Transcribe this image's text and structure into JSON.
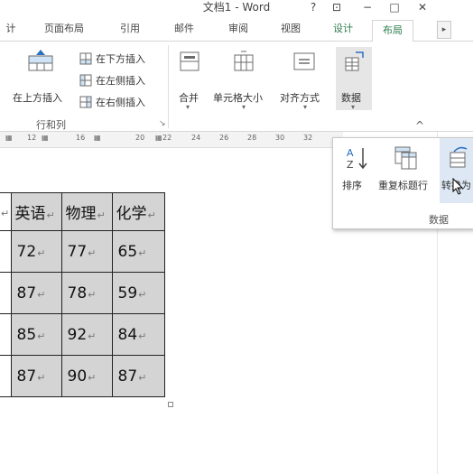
{
  "window": {
    "title": "文档1 - Word",
    "help": "?",
    "ribbon_display": "⊡",
    "minimize": "−",
    "maximize": "□",
    "close": "✕"
  },
  "tabs": [
    "计",
    "页面布局",
    "引用",
    "邮件",
    "审阅",
    "视图",
    "设计",
    "布局"
  ],
  "tab_scroll": "▸",
  "ribbon": {
    "insert_above": "在上方插入",
    "insert_below": "在下方插入",
    "insert_left": "在左侧插入",
    "insert_right": "在右侧插入",
    "group_rows_cols": "行和列",
    "merge": "合并",
    "cell_size": "单元格大小",
    "alignment": "对齐方式",
    "data": "数据",
    "dropdown": "▾",
    "launcher": "↘",
    "collapse": "^"
  },
  "ruler": [
    "12",
    "16",
    "20",
    "22",
    "24",
    "26",
    "28",
    "30",
    "32"
  ],
  "popup": {
    "sort": "排序",
    "repeat_header": "重复标题行",
    "convert": "转换为",
    "group": "数据"
  },
  "table": {
    "headers": [
      "英语",
      "物理",
      "化学"
    ],
    "rows": [
      [
        "72",
        "77",
        "65"
      ],
      [
        "87",
        "78",
        "59"
      ],
      [
        "85",
        "92",
        "84"
      ],
      [
        "87",
        "90",
        "87"
      ]
    ],
    "cell_mark": "↵"
  }
}
